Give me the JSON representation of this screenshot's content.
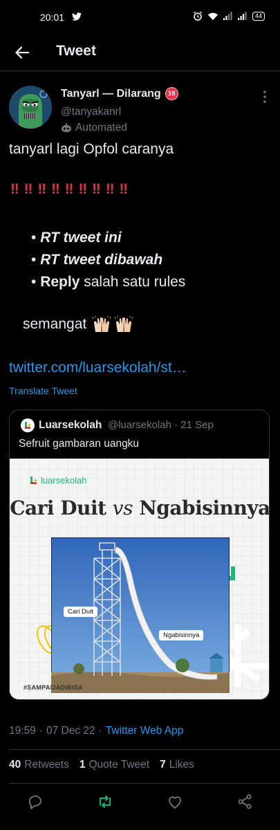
{
  "status_bar": {
    "time": "20:01",
    "battery": "44"
  },
  "header": {
    "title": "Tweet"
  },
  "author": {
    "name": "Tanyarl — Dilarang",
    "age_badge": "18",
    "handle": "@tanyakanrl",
    "automated_label": "Automated"
  },
  "tweet": {
    "line1": "tanyarl lagi Opfol caranya",
    "bang": "‼",
    "rules": [
      {
        "bullet": "•",
        "bold": "RT tweet ini",
        "rest": ""
      },
      {
        "bullet": "•",
        "bold": "RT tweet dibawah",
        "rest": ""
      },
      {
        "bullet": "•",
        "bold": "Reply",
        "rest": " salah satu rules"
      }
    ],
    "semangat": "semangat",
    "link": "twitter.com/luarsekolah/st…",
    "translate": "Translate Tweet"
  },
  "quote": {
    "name": "Luarsekolah",
    "meta": "@luarsekolah · 21 Sep",
    "text": "Sefruit gambaran uangku",
    "image": {
      "brand": "luarsekolah",
      "title_left": "Cari Duit",
      "title_vs": "vs",
      "title_right": "Ngabisinnya",
      "label_left": "Cari Duit",
      "label_right": "Ngabisinnya",
      "hashtag": "#SAMPAIJADIBISA"
    }
  },
  "meta": {
    "time": "19:59",
    "date": "07 Dec 22",
    "sep": "·",
    "via": "Twitter Web App"
  },
  "stats": {
    "retweets_count": "40",
    "retweets_label": "Retweets",
    "quotes_count": "1",
    "quotes_label": "Quote Tweet",
    "likes_count": "7",
    "likes_label": "Likes"
  },
  "colors": {
    "accent": "#1d9bf0",
    "retweet": "#00ba7c",
    "bang": "#e0313b"
  }
}
